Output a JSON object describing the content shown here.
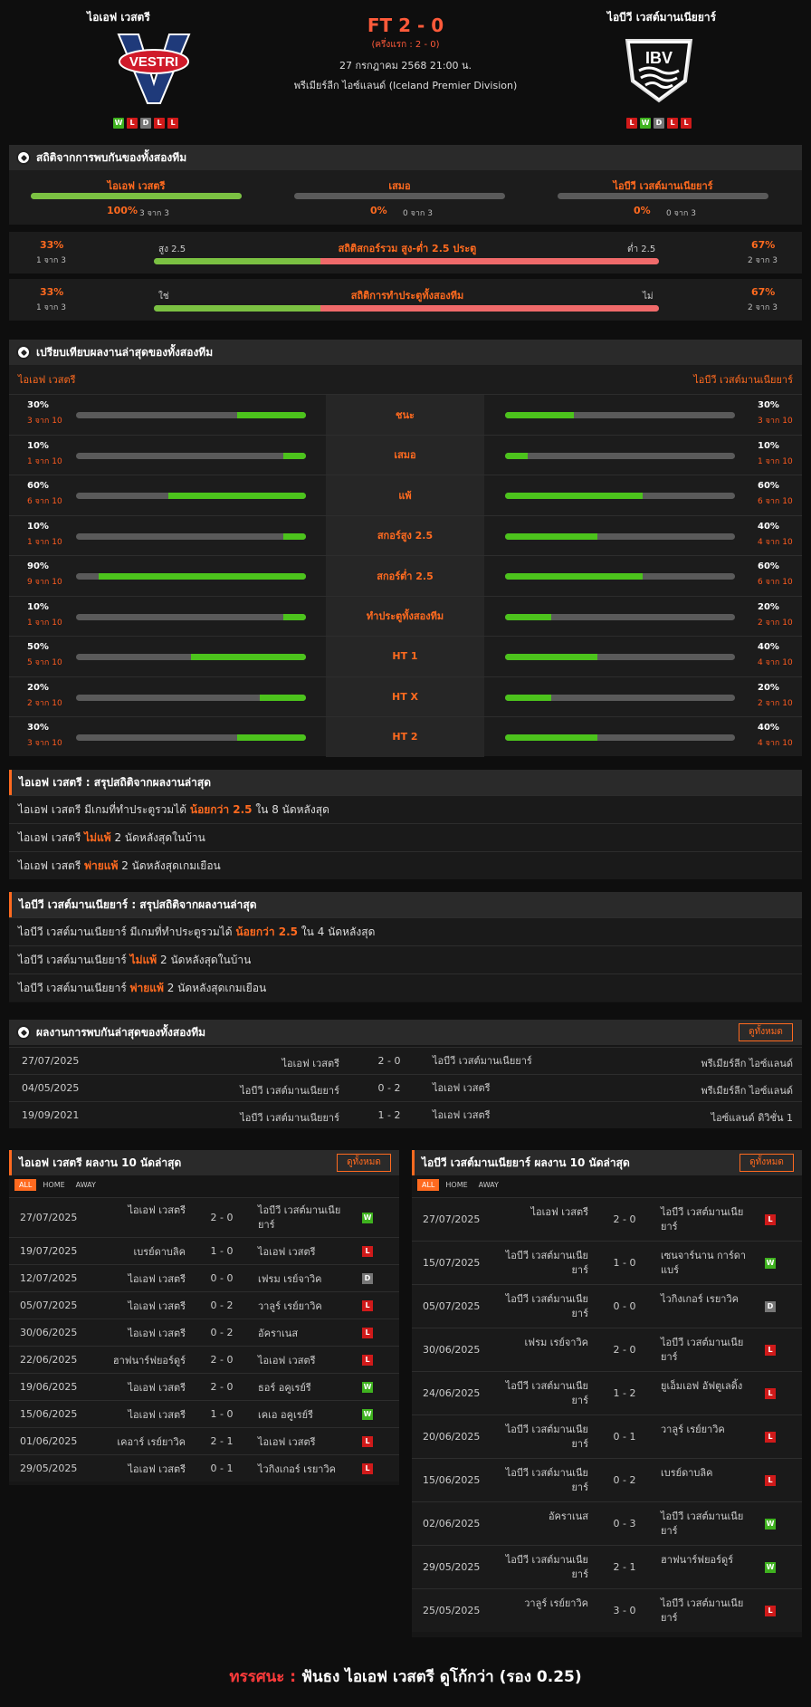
{
  "home": {
    "name": "ไอเอฟ เวสตรี",
    "form": [
      "W",
      "L",
      "D",
      "L",
      "L"
    ],
    "logo_text": "VESTRI"
  },
  "away": {
    "name": "ไอบีวี เวสต์มานเนียยาร์",
    "form": [
      "L",
      "W",
      "D",
      "L",
      "L"
    ],
    "logo_text": "IBV"
  },
  "match": {
    "ft": "FT 2 - 0",
    "ht": "(ครึ่งแรก : 2 - 0)",
    "datetime": "27 กรกฎาคม 2568 21:00 น.",
    "league": "พรีเมียร์ลีก ไอซ์แลนด์ (Iceland Premier Division)"
  },
  "h2h": {
    "title": "สถิติจากการพบกันของทั้งสองทีม",
    "cols": [
      {
        "label": "ไอเอฟ เวสตรี",
        "pct": "100%",
        "sub": "3 จาก 3",
        "fill": 1.0
      },
      {
        "label": "เสมอ",
        "pct": "0%",
        "sub": "0 จาก 3",
        "fill": 0
      },
      {
        "label": "ไอบีวี เวสต์มานเนียยาร์",
        "pct": "0%",
        "sub": "0 จาก 3",
        "fill": 0
      }
    ],
    "ou": {
      "title": "สถิติสกอร์รวม สูง-ต่ำ 2.5 ประตู",
      "left_pct": "33%",
      "left_sub": "1 จาก 3",
      "left_lbl": "สูง 2.5",
      "right_lbl": "ต่ำ 2.5",
      "right_pct": "67%",
      "right_sub": "2 จาก 3",
      "fill": 0.33
    },
    "btts": {
      "title": "สถิติการทำประตูทั้งสองทีม",
      "left_pct": "33%",
      "left_sub": "1 จาก 3",
      "left_lbl": "ใช่",
      "right_lbl": "ไม่",
      "right_pct": "67%",
      "right_sub": "2 จาก 3",
      "fill": 0.33
    }
  },
  "compare": {
    "title": "เปรียบเทียบผลงานล่าสุดของทั้งสองทีม",
    "home_label": "ไอเอฟ เวสตรี",
    "away_label": "ไอบีวี เวสต์มานเนียยาร์",
    "rows": [
      {
        "label": "ชนะ",
        "h_pct": "30%",
        "h_sub": "3 จาก 10",
        "h": 0.3,
        "a_pct": "30%",
        "a_sub": "3 จาก 10",
        "a": 0.3
      },
      {
        "label": "เสมอ",
        "h_pct": "10%",
        "h_sub": "1 จาก 10",
        "h": 0.1,
        "a_pct": "10%",
        "a_sub": "1 จาก 10",
        "a": 0.1
      },
      {
        "label": "แพ้",
        "h_pct": "60%",
        "h_sub": "6 จาก 10",
        "h": 0.6,
        "a_pct": "60%",
        "a_sub": "6 จาก 10",
        "a": 0.6
      },
      {
        "label": "สกอร์สูง 2.5",
        "h_pct": "10%",
        "h_sub": "1 จาก 10",
        "h": 0.1,
        "a_pct": "40%",
        "a_sub": "4 จาก 10",
        "a": 0.4
      },
      {
        "label": "สกอร์ต่ำ 2.5",
        "h_pct": "90%",
        "h_sub": "9 จาก 10",
        "h": 0.9,
        "a_pct": "60%",
        "a_sub": "6 จาก 10",
        "a": 0.6
      },
      {
        "label": "ทำประตูทั้งสองทีม",
        "h_pct": "10%",
        "h_sub": "1 จาก 10",
        "h": 0.1,
        "a_pct": "20%",
        "a_sub": "2 จาก 10",
        "a": 0.2
      },
      {
        "label": "HT 1",
        "h_pct": "50%",
        "h_sub": "5 จาก 10",
        "h": 0.5,
        "a_pct": "40%",
        "a_sub": "4 จาก 10",
        "a": 0.4
      },
      {
        "label": "HT X",
        "h_pct": "20%",
        "h_sub": "2 จาก 10",
        "h": 0.2,
        "a_pct": "20%",
        "a_sub": "2 จาก 10",
        "a": 0.2
      },
      {
        "label": "HT 2",
        "h_pct": "30%",
        "h_sub": "3 จาก 10",
        "h": 0.3,
        "a_pct": "40%",
        "a_sub": "4 จาก 10",
        "a": 0.4
      }
    ]
  },
  "summary_home": {
    "title": "ไอเอฟ เวสตรี : สรุปสถิติจากผลงานล่าสุด",
    "lines": [
      {
        "pre": "ไอเอฟ เวสตรี  มีเกมที่ทำประตูรวมได้ ",
        "hi": "น้อยกว่า  2.5",
        "post": "  ใน 8 นัดหลังสุด"
      },
      {
        "pre": "ไอเอฟ เวสตรี ",
        "hi": "ไม่แพ้",
        "post": "  2  นัดหลังสุดในบ้าน"
      },
      {
        "pre": "ไอเอฟ เวสตรี ",
        "hi": "พ่ายแพ้",
        "post": "  2  นัดหลังสุดเกมเยือน"
      }
    ]
  },
  "summary_away": {
    "title": "ไอบีวี เวสต์มานเนียยาร์ : สรุปสถิติจากผลงานล่าสุด",
    "lines": [
      {
        "pre": "ไอบีวี เวสต์มานเนียยาร์  มีเกมที่ทำประตูรวมได้ ",
        "hi": "น้อยกว่า  2.5",
        "post": "  ใน 4 นัดหลังสุด"
      },
      {
        "pre": "ไอบีวี เวสต์มานเนียยาร์ ",
        "hi": "ไม่แพ้",
        "post": "  2  นัดหลังสุดในบ้าน"
      },
      {
        "pre": "ไอบีวี เวสต์มานเนียยาร์ ",
        "hi": "พ่ายแพ้",
        "post": "  2  นัดหลังสุดเกมเยือน"
      }
    ]
  },
  "h2h_results": {
    "title": "ผลงานการพบกันล่าสุดของทั้งสองทีม",
    "view_all": "ดูทั้งหมด",
    "rows": [
      {
        "date": "27/07/2025",
        "home": "ไอเอฟ เวสตรี",
        "score": "2 - 0",
        "away": "ไอบีวี เวสต์มานเนียยาร์",
        "league": "พรีเมียร์ลีก ไอซ์แลนด์"
      },
      {
        "date": "04/05/2025",
        "home": "ไอบีวี เวสต์มานเนียยาร์",
        "score": "0 - 2",
        "away": "ไอเอฟ เวสตรี",
        "league": "พรีเมียร์ลีก ไอซ์แลนด์"
      },
      {
        "date": "19/09/2021",
        "home": "ไอบีวี เวสต์มานเนียยาร์",
        "score": "1 - 2",
        "away": "ไอเอฟ เวสตรี",
        "league": "ไอซ์แลนด์ ดิวิชั่น 1"
      }
    ]
  },
  "last10_home": {
    "title": "ไอเอฟ เวสตรี ผลงาน 10 นัดล่าสุด",
    "view_all": "ดูทั้งหมด",
    "tabs": [
      "ALL",
      "HOME",
      "AWAY"
    ],
    "rows": [
      {
        "date": "27/07/2025",
        "home": "ไอเอฟ เวสตรี",
        "score": "2 - 0",
        "away": "ไอบีวี เวสต์มานเนีย ยาร์",
        "r": "W"
      },
      {
        "date": "19/07/2025",
        "home": "เบรย์ดาบลิค",
        "score": "1 - 0",
        "away": "ไอเอฟ เวสตรี",
        "r": "L"
      },
      {
        "date": "12/07/2025",
        "home": "ไอเอฟ เวสตรี",
        "score": "0 - 0",
        "away": "เฟรม เรย์จาวิค",
        "r": "D"
      },
      {
        "date": "05/07/2025",
        "home": "ไอเอฟ เวสตรี",
        "score": "0 - 2",
        "away": "วาลูร์ เรย์ยาวิค",
        "r": "L"
      },
      {
        "date": "30/06/2025",
        "home": "ไอเอฟ เวสตรี",
        "score": "0 - 2",
        "away": "อัคราเนส",
        "r": "L"
      },
      {
        "date": "22/06/2025",
        "home": "ฮาฟนาร์ฟยอร์ดูร์",
        "score": "2 - 0",
        "away": "ไอเอฟ เวสตรี",
        "r": "L"
      },
      {
        "date": "19/06/2025",
        "home": "ไอเอฟ เวสตรี",
        "score": "2 - 0",
        "away": "ธอร์ อคูเรย์รี",
        "r": "W"
      },
      {
        "date": "15/06/2025",
        "home": "ไอเอฟ เวสตรี",
        "score": "1 - 0",
        "away": "เคเอ อคูเรย์รี",
        "r": "W"
      },
      {
        "date": "01/06/2025",
        "home": "เคอาร์ เรย์ยาวิค",
        "score": "2 - 1",
        "away": "ไอเอฟ เวสตรี",
        "r": "L"
      },
      {
        "date": "29/05/2025",
        "home": "ไอเอฟ เวสตรี",
        "score": "0 - 1",
        "away": "ไวกิงเกอร์ เรยาวิค",
        "r": "L"
      }
    ]
  },
  "last10_away": {
    "title": "ไอบีวี เวสต์มานเนียยาร์ ผลงาน 10 นัดล่าสุด",
    "view_all": "ดูทั้งหมด",
    "tabs": [
      "ALL",
      "HOME",
      "AWAY"
    ],
    "rows": [
      {
        "date": "27/07/2025",
        "home": "ไอเอฟ เวสตรี",
        "score": "2 - 0",
        "away": "ไอบีวี เวสต์มานเนีย ยาร์",
        "r": "L"
      },
      {
        "date": "15/07/2025",
        "home": "ไอบีวี เวสต์มานเนีย ยาร์",
        "score": "1 - 0",
        "away": "เซนจาร์นาน การ์ดา แบร์",
        "r": "W"
      },
      {
        "date": "05/07/2025",
        "home": "ไอบีวี เวสต์มานเนีย ยาร์",
        "score": "0 - 0",
        "away": "ไวกิงเกอร์ เรยาวิค",
        "r": "D"
      },
      {
        "date": "30/06/2025",
        "home": "เฟรม เรย์จาวิค",
        "score": "2 - 0",
        "away": "ไอบีวี เวสต์มานเนีย ยาร์",
        "r": "L"
      },
      {
        "date": "24/06/2025",
        "home": "ไอบีวี เวสต์มานเนีย ยาร์",
        "score": "1 - 2",
        "away": "ยูเอ็มเอฟ อัฟตูเลดิ้ง",
        "r": "L"
      },
      {
        "date": "20/06/2025",
        "home": "ไอบีวี เวสต์มานเนีย ยาร์",
        "score": "0 - 1",
        "away": "วาลูร์ เรย์ยาวิค",
        "r": "L"
      },
      {
        "date": "15/06/2025",
        "home": "ไอบีวี เวสต์มานเนีย ยาร์",
        "score": "0 - 2",
        "away": "เบรย์ดาบลิค",
        "r": "L"
      },
      {
        "date": "02/06/2025",
        "home": "อัคราเนส",
        "score": "0 - 3",
        "away": "ไอบีวี เวสต์มานเนีย ยาร์",
        "r": "W"
      },
      {
        "date": "29/05/2025",
        "home": "ไอบีวี เวสต์มานเนีย ยาร์",
        "score": "2 - 1",
        "away": "ฮาฟนาร์ฟยอร์ดูร์",
        "r": "W"
      },
      {
        "date": "25/05/2025",
        "home": "วาลูร์ เรย์ยาวิค",
        "score": "3 - 0",
        "away": "ไอบีวี เวสต์มานเนีย ยาร์",
        "r": "L"
      }
    ]
  },
  "verdict": {
    "label": "ทรรศนะ :",
    "text": "ฟันธง ไอเอฟ เวสตรี ดูโก้กว่า (รอง 0.25)"
  },
  "colors": {
    "accent": "#ff6a1f",
    "win": "#3fb21f",
    "loss": "#d01a1a",
    "draw": "#777777",
    "bar_green": "#4cc31c",
    "bar_red": "#f06a6a"
  }
}
